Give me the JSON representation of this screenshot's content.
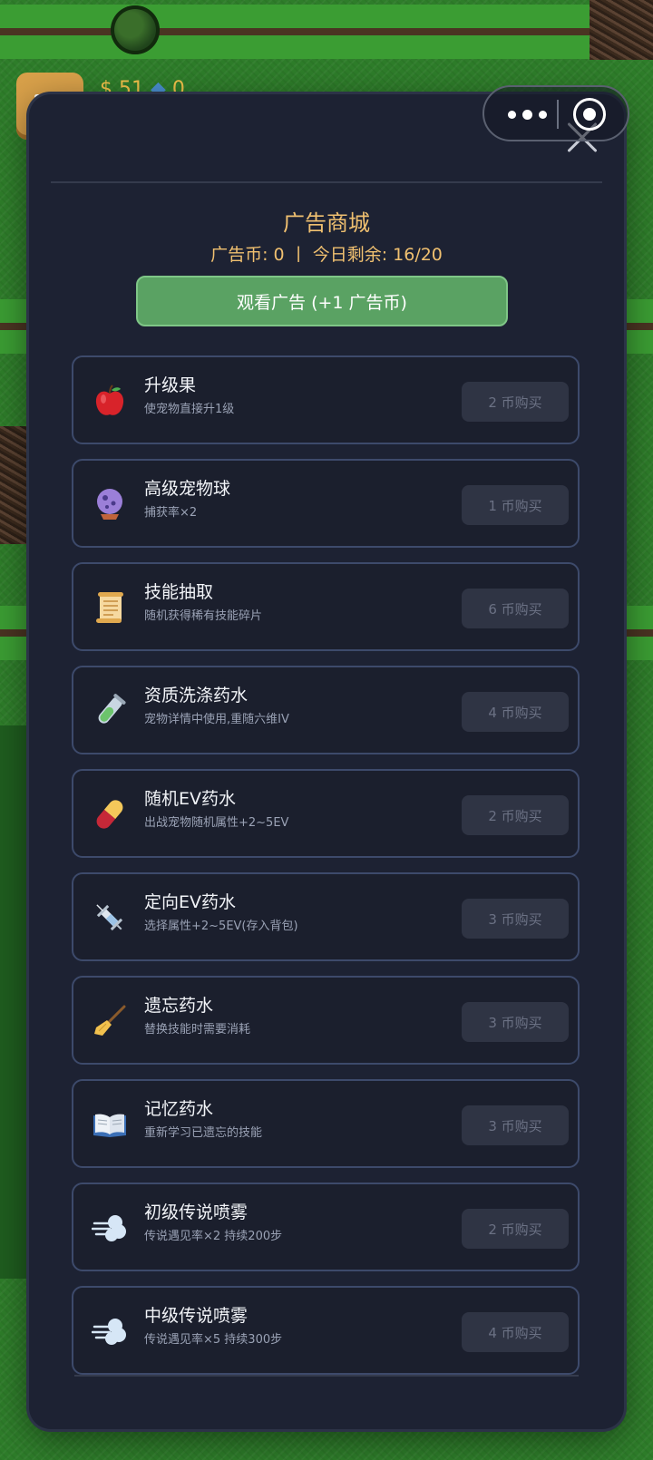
{
  "hud": {
    "money": "$ 51",
    "gems": "0"
  },
  "modal": {
    "title": "广告商城",
    "subtitle": "广告币: 0 丨 今日剩余: 16/20",
    "watch_button": "观看广告 (+1 广告币)"
  },
  "items": [
    {
      "icon": "apple-icon",
      "name": "升级果",
      "desc": "使宠物直接升1级",
      "price": "2 币购买"
    },
    {
      "icon": "crystal-ball-icon",
      "name": "高级宠物球",
      "desc": "捕获率×2",
      "price": "1 币购买"
    },
    {
      "icon": "scroll-icon",
      "name": "技能抽取",
      "desc": "随机获得稀有技能碎片",
      "price": "6 币购买"
    },
    {
      "icon": "test-tube-icon",
      "name": "资质洗涤药水",
      "desc": "宠物详情中使用,重随六维IV",
      "price": "4 币购买"
    },
    {
      "icon": "pill-icon",
      "name": "随机EV药水",
      "desc": "出战宠物随机属性+2~5EV",
      "price": "2 币购买"
    },
    {
      "icon": "syringe-icon",
      "name": "定向EV药水",
      "desc": "选择属性+2~5EV(存入背包)",
      "price": "3 币购买"
    },
    {
      "icon": "broom-icon",
      "name": "遗忘药水",
      "desc": "替换技能时需要消耗",
      "price": "3 币购买"
    },
    {
      "icon": "open-book-icon",
      "name": "记忆药水",
      "desc": "重新学习已遗忘的技能",
      "price": "3 币购买"
    },
    {
      "icon": "wind-icon",
      "name": "初级传说喷雾",
      "desc": "传说遇见率×2 持续200步",
      "price": "2 币购买"
    },
    {
      "icon": "wind-icon",
      "name": "中级传说喷雾",
      "desc": "传说遇见率×5 持续300步",
      "price": "4 币购买"
    }
  ]
}
